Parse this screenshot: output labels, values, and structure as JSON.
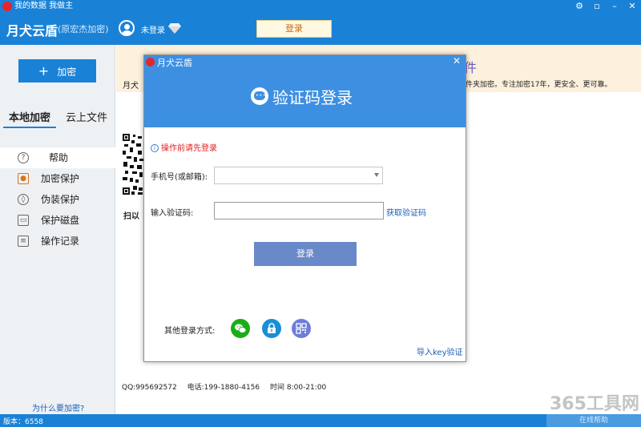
{
  "titlebar": {
    "title": "我的数据 我做主"
  },
  "header": {
    "brand": "月犬云盾",
    "brand_sub": "(原宏杰加密)",
    "login_status": "未登录",
    "login_button": "登录"
  },
  "sidebar": {
    "encrypt_button": "加密",
    "tabs": [
      {
        "label": "本地加密"
      },
      {
        "label": "云上文件"
      }
    ],
    "items": [
      {
        "label": "帮助",
        "icon": "help-icon"
      },
      {
        "label": "加密保护",
        "icon": "lock-icon"
      },
      {
        "label": "伪装保护",
        "icon": "shield-icon"
      },
      {
        "label": "保护磁盘",
        "icon": "disk-icon"
      },
      {
        "label": "操作记录",
        "icon": "clipboard-icon"
      }
    ],
    "why_link": "为什么要加密?"
  },
  "main": {
    "banner_title_tail": "件",
    "banner_left": "月犬",
    "banner_right": "件夹加密。专注加密17年，更安全、更可靠。",
    "scan_text": "扫以",
    "contact": {
      "qq": "QQ:995692572",
      "phone": "电话:199-1880-4156",
      "hours": "时间 8:00-21:00"
    },
    "watermark": "365工具网"
  },
  "status": {
    "version": "版本：6558",
    "online_help": "在线帮助"
  },
  "modal": {
    "app_name": "月犬云盾",
    "title": "验证码登录",
    "warning": "操作前请先登录",
    "phone_label": "手机号(或邮箱):",
    "phone_value": "",
    "code_label": "输入验证码:",
    "code_value": "",
    "get_code": "获取验证码",
    "submit": "登录",
    "other_methods_label": "其他登录方式:",
    "import_key": "导入key验证"
  },
  "colors": {
    "primary": "#1a82d6",
    "modal_header": "#3d8fe2",
    "submit_button": "#6a89c9",
    "warning": "#e02020",
    "link": "#1a5fb4"
  }
}
